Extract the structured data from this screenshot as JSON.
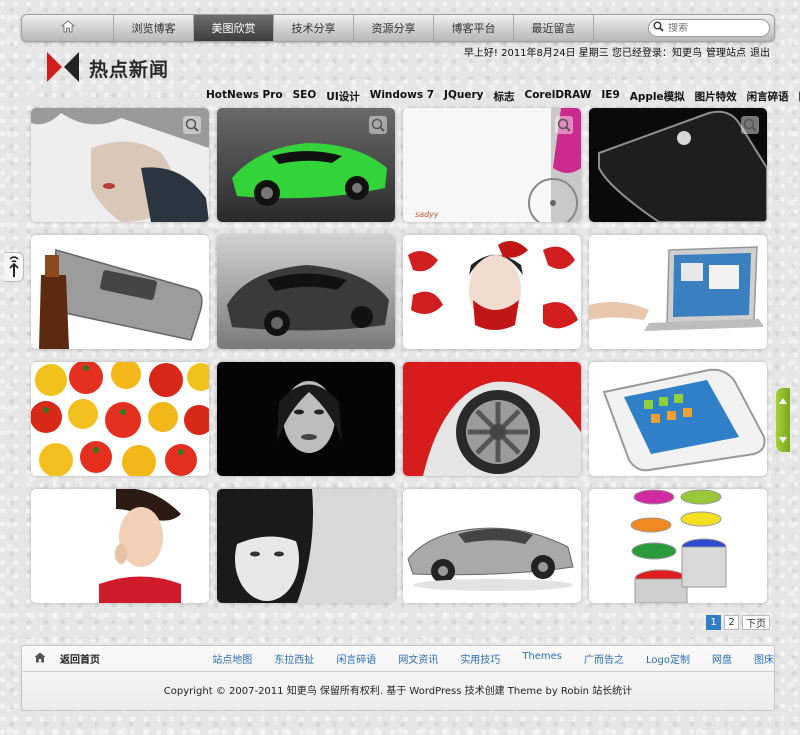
{
  "nav": {
    "items": [
      "浏览博客",
      "美图欣赏",
      "技术分享",
      "资源分享",
      "博客平台",
      "最近留言"
    ],
    "active_index": 1
  },
  "search": {
    "placeholder": "搜索"
  },
  "header": {
    "greeting": "早上好! 2011年8月24日 星期三 您已经登录：知更鸟",
    "manage_label": "管理站点",
    "logout_label": "退出",
    "logo_text": "热点新闻"
  },
  "tags": [
    "HotNews Pro",
    "SEO",
    "UI设计",
    "Windows 7",
    "JQuery",
    "标志",
    "CorelDRAW",
    "IE9",
    "Apple模拟",
    "图片特效",
    "闲言碎语",
    "图床"
  ],
  "gallery": {
    "watermark": "sadyy"
  },
  "pagination": {
    "pages": [
      "1",
      "2"
    ],
    "current": "1",
    "next_label": "下页"
  },
  "footer": {
    "home_label": "返回首页",
    "links": [
      "站点地图",
      "东拉西扯",
      "闲言碎语",
      "网文资讯",
      "实用技巧",
      "Themes",
      "广而告之",
      "Logo定制",
      "网盘",
      "图床"
    ],
    "copyright_prefix": "Copyright © 2007-2011 知更鸟  保留所有权利.  基于 WordPress 技术创建  Theme by Robin",
    "stats_label": "站长统计"
  },
  "colors": {
    "accent_blue": "#2e7fc8",
    "link_blue": "#2a6fb5",
    "side_green": "#8cbc2c",
    "logo_red": "#d01f1f"
  }
}
